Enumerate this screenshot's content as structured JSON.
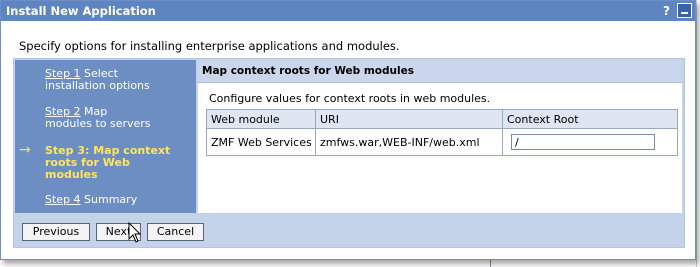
{
  "window": {
    "title": "Install New Application",
    "help_glyph": "?"
  },
  "intro_text": "Specify options for installing enterprise applications and modules.",
  "steps": [
    {
      "label": "Step 1",
      "desc_line1": "Select",
      "desc_line2": "installation options"
    },
    {
      "label": "Step 2",
      "desc_line1": "Map",
      "desc_line2": "modules to servers"
    },
    {
      "label": "Step 3: Map context",
      "desc_line2": "roots for Web",
      "desc_line3": "modules",
      "current": true
    },
    {
      "label": "Step 4",
      "desc_line1": "Summary"
    }
  ],
  "current_arrow": "→",
  "panel": {
    "title": "Map context roots for Web modules",
    "description": "Configure values for context roots in web modules."
  },
  "table": {
    "headers": [
      "Web module",
      "URI",
      "Context Root"
    ],
    "rows": [
      {
        "web_module": "ZMF Web Services",
        "uri": "zmfws.war,WEB-INF/web.xml",
        "context_root": "/"
      }
    ]
  },
  "buttons": {
    "previous": "Previous",
    "next": "Next",
    "cancel": "Cancel"
  },
  "colors": {
    "titlebar": "#5e85c1",
    "steps_panel": "#6d8ec2",
    "current_step": "#ffe65a",
    "wizard_bg": "#c5d3ea"
  }
}
